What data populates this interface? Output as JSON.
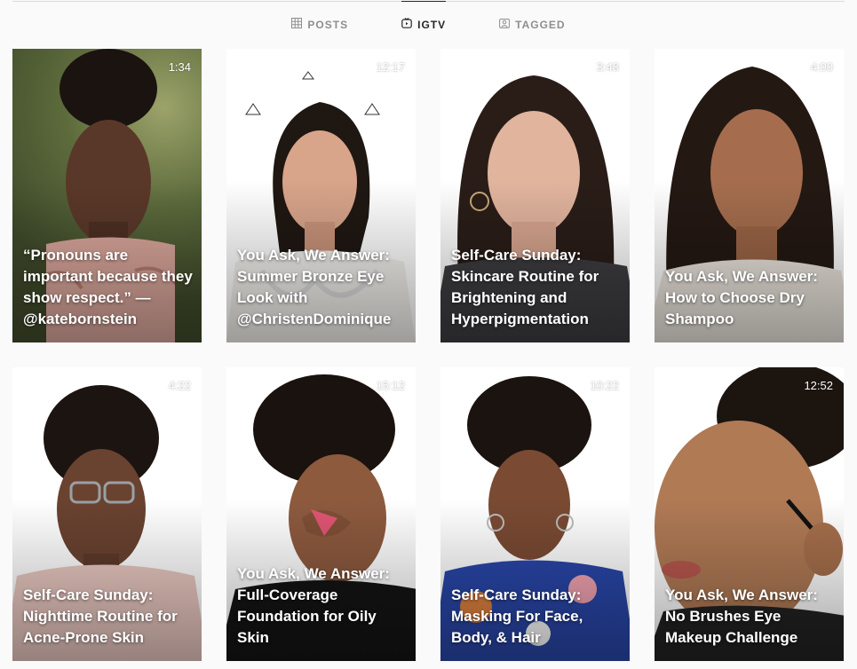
{
  "tabs": [
    {
      "label": "POSTS",
      "icon": "grid-icon",
      "active": false
    },
    {
      "label": "IGTV",
      "icon": "igtv-icon",
      "active": true
    },
    {
      "label": "TAGGED",
      "icon": "tagged-icon",
      "active": false
    }
  ],
  "videos": [
    {
      "duration": "1:34",
      "title": "“Pronouns are important because they show respect.” — @katebornstein"
    },
    {
      "duration": "12:17",
      "title": "You Ask, We Answer: Summer Bronze Eye Look with @ChristenDominique"
    },
    {
      "duration": "3:48",
      "title": "Self-Care Sunday: Skincare Routine for Brightening and Hyperpigmentation"
    },
    {
      "duration": "4:00",
      "title": "You Ask, We Answer: How to Choose Dry Shampoo"
    },
    {
      "duration": "4:22",
      "title": "Self-Care Sunday: Nighttime Routine for Acne-Prone Skin"
    },
    {
      "duration": "15:12",
      "title": "You Ask, We Answer: Full-Coverage Foundation for Oily Skin"
    },
    {
      "duration": "10:22",
      "title": "Self-Care Sunday: Masking For Face, Body, & Hair"
    },
    {
      "duration": "12:52",
      "title": "You Ask, We Answer: No Brushes Eye Makeup Challenge"
    }
  ],
  "colors": {
    "background": "#fafafa",
    "tab_active": "#262626",
    "tab_inactive": "#8e8e8e"
  }
}
